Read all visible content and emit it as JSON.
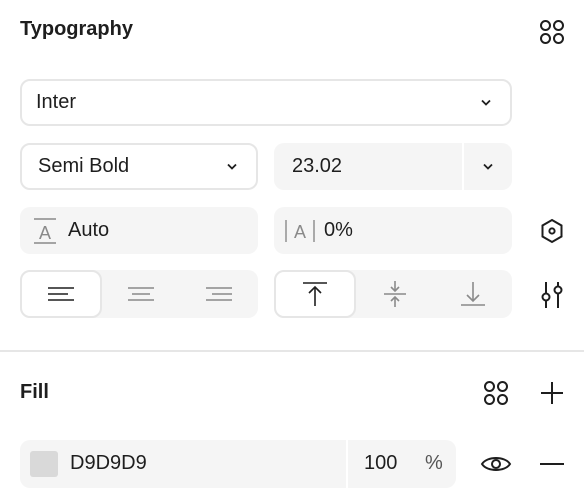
{
  "typography": {
    "title": "Typography",
    "font_family": "Inter",
    "font_weight": "Semi Bold",
    "font_size": "23.02",
    "line_height": "Auto",
    "letter_spacing": "0%"
  },
  "fill": {
    "title": "Fill",
    "color_hex": "D9D9D9",
    "swatch_color": "#D9D9D9",
    "opacity": "100",
    "opacity_unit": "%"
  },
  "icons": {
    "styles": "grid-dots-icon",
    "variable": "hexagon-icon",
    "settings": "sliders-icon",
    "add": "plus-icon",
    "visibility": "eye-icon",
    "remove": "minus-icon"
  }
}
